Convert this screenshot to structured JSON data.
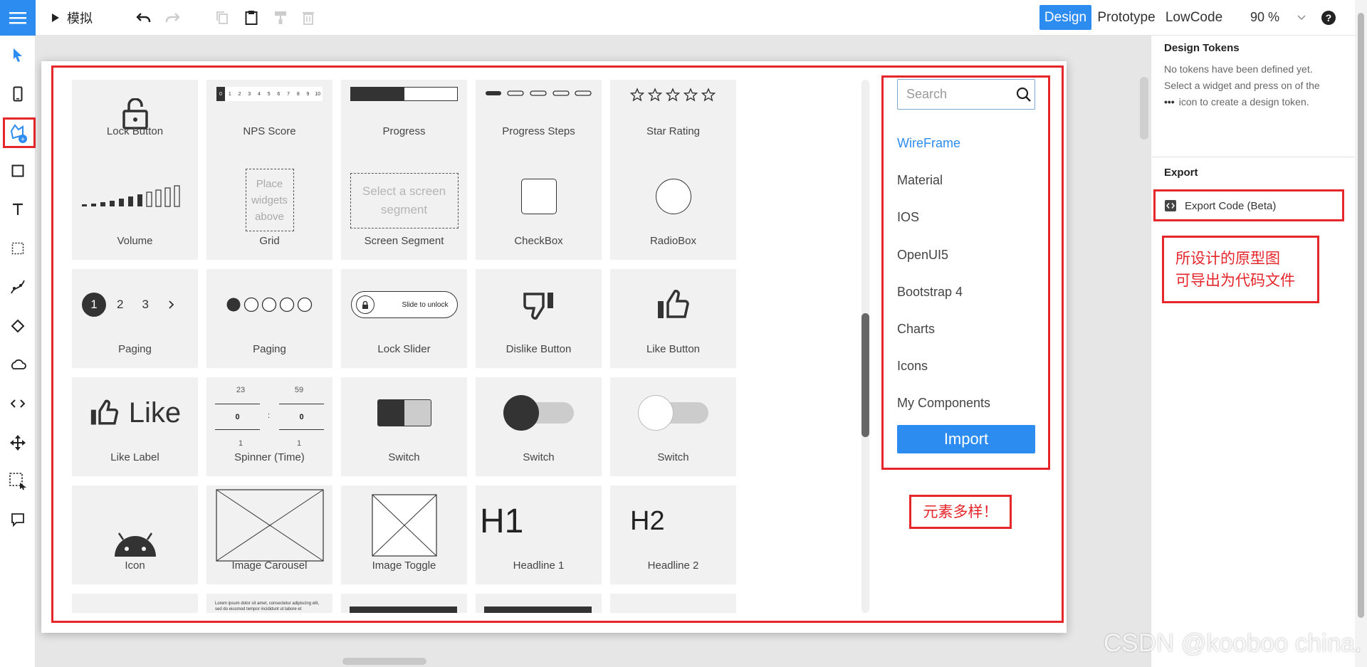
{
  "toolbar": {
    "simulate_label": "模拟",
    "modes": [
      {
        "label": "Design",
        "active": true
      },
      {
        "label": "Prototype",
        "active": false
      },
      {
        "label": "LowCode",
        "active": false
      }
    ],
    "zoom": "90 %",
    "help_icon": "question-circle-icon"
  },
  "left_tools": [
    "pointer-icon",
    "phone-icon",
    "widget-library-icon",
    "rectangle-icon",
    "text-icon",
    "dotted-rect-icon",
    "path-icon",
    "diamond-icon",
    "cloud-icon",
    "code-icon",
    "move-icon",
    "selection-icon",
    "comment-icon"
  ],
  "widgets": {
    "row1": [
      "Lock Button",
      "NPS Score",
      "Progress",
      "Progress Steps",
      "Star Rating"
    ],
    "row2": [
      "Volume",
      "Grid",
      "Screen Segment",
      "CheckBox",
      "RadioBox"
    ],
    "row3": [
      "Paging",
      "Paging",
      "Lock Slider",
      "Dislike Button",
      "Like Button"
    ],
    "row4": [
      "Like Label",
      "Spinner (Time)",
      "Switch",
      "Switch",
      "Switch"
    ],
    "row5": [
      "Icon",
      "Image Carousel",
      "Image Toggle",
      "Headline 1",
      "Headline 2"
    ],
    "previews": {
      "nps_numbers": [
        "0",
        "1",
        "2",
        "3",
        "4",
        "5",
        "6",
        "7",
        "8",
        "9",
        "10"
      ],
      "grid_placeholder": "Place widgets above",
      "segment_placeholder": "Select a screen segment",
      "paging_numbers": [
        "1",
        "2",
        "3"
      ],
      "lock_slider_text": "Slide to unlock",
      "like_text": "Like",
      "spinner_top": [
        "23",
        "59"
      ],
      "spinner_value": [
        "0",
        "0"
      ],
      "spinner_bottom": [
        "1",
        "1"
      ],
      "h1": "H1",
      "h2": "H2",
      "lorem": "Lorem ipsum dolor sit amet, consectetur adipiscing elit, sed do eiusmod tempor incididunt ut labore et"
    }
  },
  "library": {
    "search_placeholder": "Search",
    "items": [
      {
        "label": "WireFrame",
        "active": true
      },
      {
        "label": "Material",
        "active": false
      },
      {
        "label": "IOS",
        "active": false
      },
      {
        "label": "OpenUI5",
        "active": false
      },
      {
        "label": "Bootstrap 4",
        "active": false
      },
      {
        "label": "Charts",
        "active": false
      },
      {
        "label": "Icons",
        "active": false
      },
      {
        "label": "My Components",
        "active": false
      }
    ],
    "import_label": "Import"
  },
  "annotations": {
    "elements_note": "元素多样！",
    "export_note_line1": "所设计的原型图",
    "export_note_line2": "可导出为代码文件"
  },
  "right_panel": {
    "tokens_title": "Design Tokens",
    "tokens_text_1": "No tokens have been defined yet.",
    "tokens_text_2": "Select a widget and press on of the",
    "tokens_text_3": "icon to create a design token.",
    "export_title": "Export",
    "export_button": "Export Code (Beta)"
  },
  "watermark": "CSDN @kooboo china.",
  "colors": {
    "accent": "#2d8cf0",
    "annotation": "#e5262b"
  }
}
